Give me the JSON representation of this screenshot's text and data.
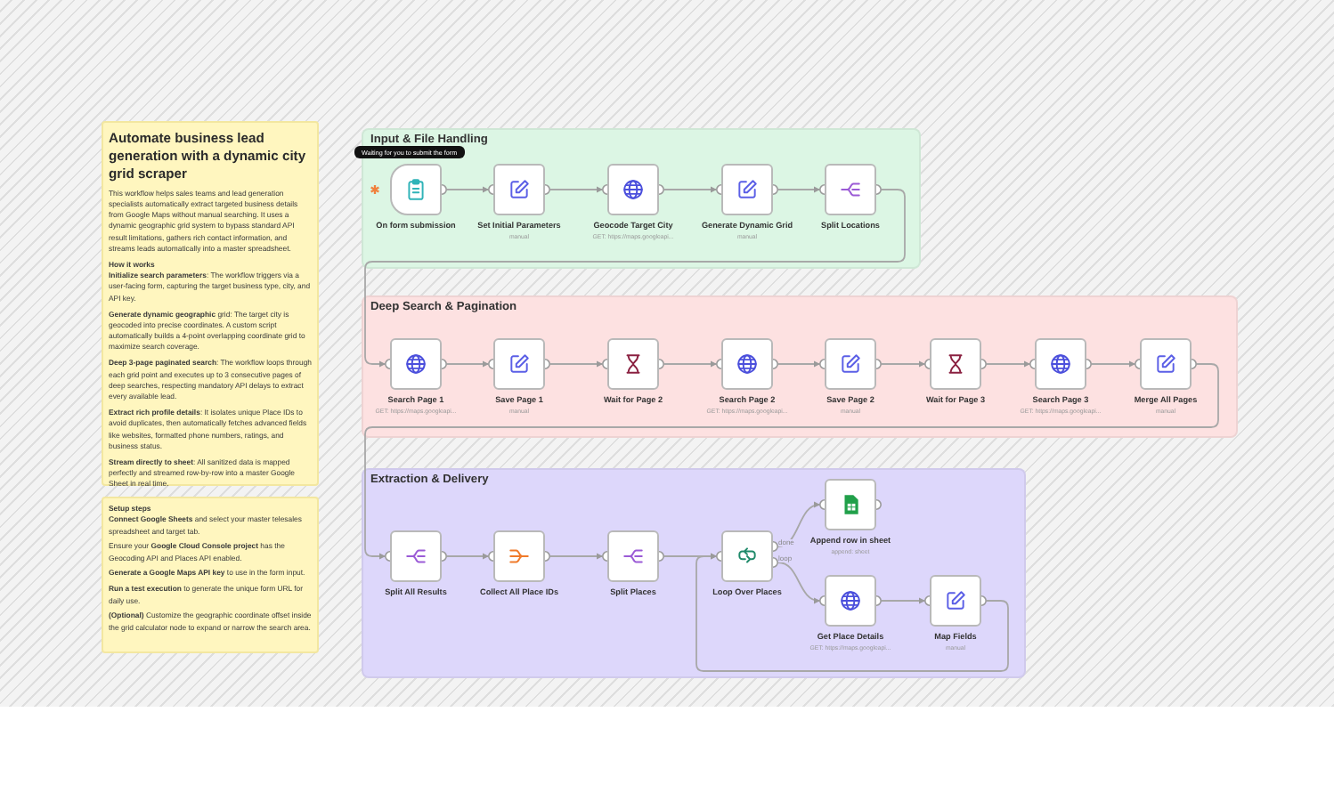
{
  "notes": [
    {
      "title": "Automate business lead generation with a dynamic city grid scraper",
      "paragraphs": [
        "This workflow helps sales teams and lead generation specialists automatically extract targeted business details from Google Maps without manual searching. It uses a dynamic geographic grid system to bypass standard API result limitations, gathers rich contact information, and streams leads automatically into a master spreadsheet.",
        "**How it works**\n**Initialize search parameters**: The workflow triggers via a user-facing form, capturing the target business type, city, and API key.",
        "**Generate dynamic geographic** grid: The target city is geocoded into precise coordinates. A custom script automatically builds a 4-point overlapping coordinate grid to maximize search coverage.",
        "**Deep 3-page paginated search**: The workflow loops through each grid point and executes up to 3 consecutive pages of deep searches, respecting mandatory API delays to extract every available lead.",
        "**Extract rich profile details**: It isolates unique Place IDs to avoid duplicates, then automatically fetches advanced fields like websites, formatted phone numbers, ratings, and business status.",
        "**Stream directly to sheet**: All sanitized data is mapped perfectly and streamed row-by-row into a master Google Sheet in real time."
      ]
    },
    {
      "paragraphs": [
        "**Setup steps**\n**Connect Google Sheets** and select your master telesales spreadsheet and target tab.",
        "Ensure your **Google Cloud Console project** has the Geocoding API and Places API enabled.",
        "**Generate a Google Maps API key** to use in the form input.",
        "**Run a test execution** to generate the unique form URL for daily use.",
        "**(Optional)** Customize the geographic coordinate offset inside the grid calculator node to expand or narrow the search area."
      ]
    }
  ],
  "tooltip": "Waiting for you to submit the form",
  "groups": [
    {
      "title": "Input & File Handling",
      "color": "#dcf6e4",
      "nodes": [
        {
          "kind": "form",
          "label": "On form submission"
        },
        {
          "kind": "set",
          "label": "Set Initial Parameters",
          "subtitle": "manual"
        },
        {
          "kind": "http",
          "label": "Geocode Target City",
          "subtitle": "GET: https://maps.googleapi..."
        },
        {
          "kind": "set",
          "label": "Generate Dynamic Grid",
          "subtitle": "manual"
        },
        {
          "kind": "split",
          "label": "Split Locations"
        }
      ]
    },
    {
      "title": "Deep Search & Pagination",
      "color": "#fde1e1",
      "nodes": [
        {
          "kind": "http",
          "label": "Search Page 1",
          "subtitle": "GET: https://maps.googleapi..."
        },
        {
          "kind": "set",
          "label": "Save Page 1",
          "subtitle": "manual"
        },
        {
          "kind": "wait",
          "label": "Wait for Page 2"
        },
        {
          "kind": "http",
          "label": "Search Page 2",
          "subtitle": "GET: https://maps.googleapi..."
        },
        {
          "kind": "set",
          "label": "Save Page 2",
          "subtitle": "manual"
        },
        {
          "kind": "wait",
          "label": "Wait for Page 3"
        },
        {
          "kind": "http",
          "label": "Search Page 3",
          "subtitle": "GET: https://maps.googleapi..."
        },
        {
          "kind": "set",
          "label": "Merge All Pages",
          "subtitle": "manual"
        }
      ]
    },
    {
      "title": "Extraction & Delivery",
      "color": "#ddd7fb",
      "nodes": [
        {
          "kind": "split",
          "label": "Split All Results"
        },
        {
          "kind": "aggregate",
          "label": "Collect All Place IDs"
        },
        {
          "kind": "split",
          "label": "Split Places"
        },
        {
          "kind": "loop",
          "label": "Loop Over Places",
          "outputs": [
            "done",
            "loop"
          ]
        },
        {
          "kind": "sheets",
          "label": "Append row in sheet",
          "subtitle": "append: sheet"
        },
        {
          "kind": "http",
          "label": "Get Place Details",
          "subtitle": "GET: https://maps.googleapi..."
        },
        {
          "kind": "set",
          "label": "Map Fields",
          "subtitle": "manual"
        }
      ]
    }
  ]
}
